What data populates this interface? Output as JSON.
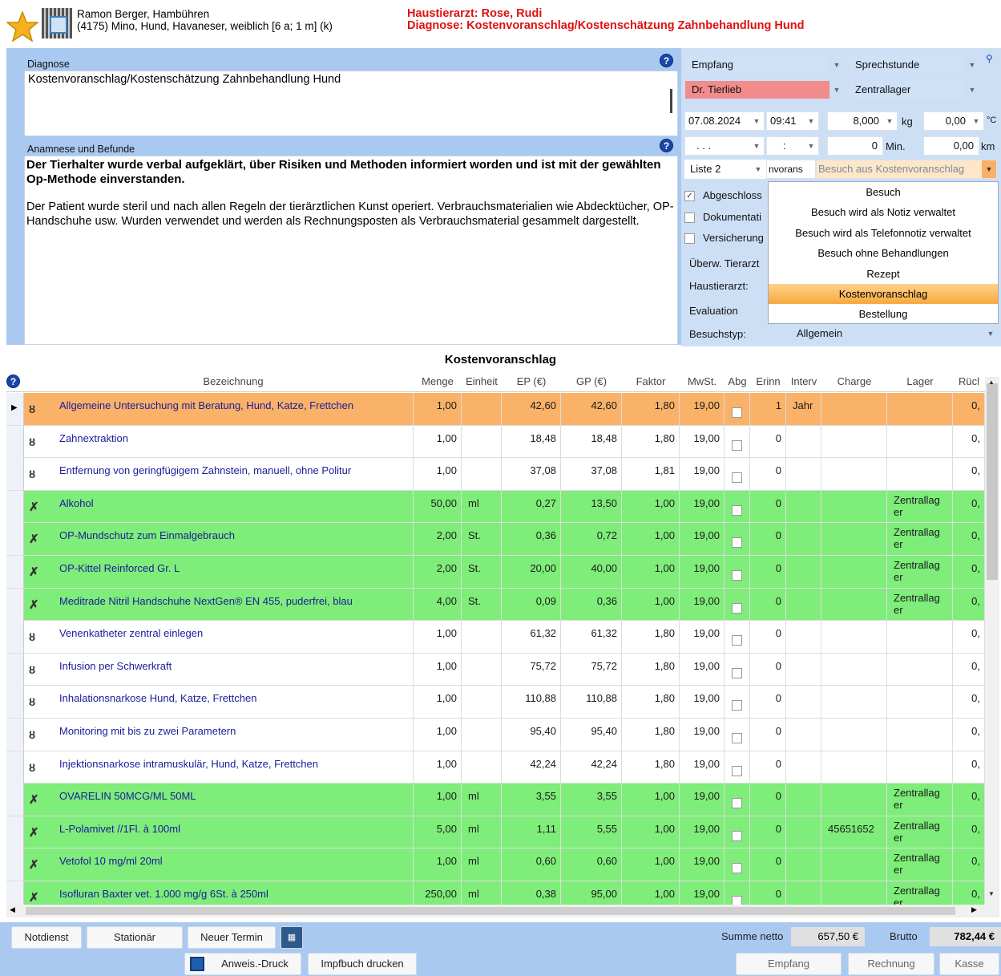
{
  "header": {
    "patient_line1": "Ramon Berger, Hambühren",
    "patient_line2": "(4175) Mino, Hund, Havaneser, weiblich [6 a; 1 m] (k)",
    "vet_line": "Haustierarzt: Rose, Rudi",
    "diagnosis_line": "Diagnose: Kostenvoranschlag/Kostenschätzung Zahnbehandlung Hund"
  },
  "left": {
    "diagnose_label": "Diagnose",
    "diagnose_text": "Kostenvoranschlag/Kostenschätzung Zahnbehandlung Hund",
    "anamnese_label": "Anamnese und Befunde",
    "anamnese_bold": "Der Tierhalter wurde verbal aufgeklärt, über Risiken und Methoden informiert worden und ist mit der gewählten Op-Methode einverstanden.",
    "anamnese_text": "Der Patient wurde steril und nach allen Regeln der tierärztlichen Kunst operiert. Verbrauchsmaterialien wie Abdecktücher, OP-Handschuhe usw. Wurden verwendet und werden als Rechnungsposten als Verbrauchsmaterial gesammelt dargestellt.",
    "help": "?"
  },
  "right": {
    "empfang": "Empfang",
    "sprechstunde": "Sprechstunde",
    "doctor": "Dr. Tierlieb",
    "lager": "Zentrallager",
    "date": "07.08.2024",
    "time": "09:41",
    "weight": "8,000",
    "weight_unit": "kg",
    "temp": "0,00",
    "temp_unit": "°C",
    "date2": ". . .",
    "time2": ":",
    "minutes": "0",
    "min_unit": "Min.",
    "km": "0,00",
    "km_unit": "km",
    "liste": "Liste 2",
    "besuchstyp_partial": "nvorans",
    "besuch_selected": "Besuch aus Kostenvoranschlag",
    "abgeschlossen": "Abgeschloss",
    "dokumentation": "Dokumentati",
    "versicherung": "Versicherung",
    "ueberw": "Überw. Tierarzt",
    "haustierarzt": "Haustierarzt:",
    "evaluation": "Evaluation",
    "besuchstyp_label": "Besuchstyp:",
    "besuchstyp_value": "Allgemein"
  },
  "popup": {
    "items": [
      "Besuch",
      "Besuch wird als Notiz verwaltet",
      "Besuch wird als Telefonnotiz verwaltet",
      "Besuch ohne Behandlungen",
      "Rezept",
      "Kostenvoranschlag",
      "Bestellung"
    ],
    "selected_index": 5
  },
  "grid": {
    "title": "Kostenvoranschlag",
    "help": "?",
    "columns": [
      "Bezeichnung",
      "Menge",
      "Einheit",
      "EP (€)",
      "GP (€)",
      "Faktor",
      "MwSt.",
      "Abg",
      "Erinn",
      "Interv",
      "Charge",
      "Lager",
      "Rücl"
    ],
    "rows": [
      {
        "type": "service",
        "name": "Allgemeine Untersuchung mit Beratung, Hund, Katze, Frettchen",
        "menge": "1,00",
        "einheit": "",
        "ep": "42,60",
        "gp": "42,60",
        "faktor": "1,80",
        "mwst": "19,00",
        "erinn": "1",
        "interv": "Jahr",
        "charge": "",
        "lager": "",
        "rueck": "0,",
        "selected": true
      },
      {
        "type": "service",
        "name": "Zahnextraktion",
        "menge": "1,00",
        "einheit": "",
        "ep": "18,48",
        "gp": "18,48",
        "faktor": "1,80",
        "mwst": "19,00",
        "erinn": "0",
        "interv": "",
        "charge": "",
        "lager": "",
        "rueck": "0,"
      },
      {
        "type": "service",
        "name": "Entfernung von geringfügigem Zahnstein, manuell, ohne Politur",
        "menge": "1,00",
        "einheit": "",
        "ep": "37,08",
        "gp": "37,08",
        "faktor": "1,81",
        "mwst": "19,00",
        "erinn": "0",
        "interv": "",
        "charge": "",
        "lager": "",
        "rueck": "0,"
      },
      {
        "type": "material",
        "name": "Alkohol",
        "menge": "50,00",
        "einheit": "ml",
        "ep": "0,27",
        "gp": "13,50",
        "faktor": "1,00",
        "mwst": "19,00",
        "erinn": "0",
        "interv": "",
        "charge": "",
        "lager": "Zentrallag er",
        "rueck": "0,"
      },
      {
        "type": "material",
        "name": "OP-Mundschutz zum Einmalgebrauch",
        "menge": "2,00",
        "einheit": "St.",
        "ep": "0,36",
        "gp": "0,72",
        "faktor": "1,00",
        "mwst": "19,00",
        "erinn": "0",
        "interv": "",
        "charge": "",
        "lager": "Zentrallag er",
        "rueck": "0,"
      },
      {
        "type": "material",
        "name": "OP-Kittel Reinforced Gr. L",
        "menge": "2,00",
        "einheit": "St.",
        "ep": "20,00",
        "gp": "40,00",
        "faktor": "1,00",
        "mwst": "19,00",
        "erinn": "0",
        "interv": "",
        "charge": "",
        "lager": "Zentrallag er",
        "rueck": "0,"
      },
      {
        "type": "material",
        "name": "Meditrade Nitril Handschuhe NextGen® EN 455, puderfrei, blau",
        "menge": "4,00",
        "einheit": "St.",
        "ep": "0,09",
        "gp": "0,36",
        "faktor": "1,00",
        "mwst": "19,00",
        "erinn": "0",
        "interv": "",
        "charge": "",
        "lager": "Zentrallag er",
        "rueck": "0,"
      },
      {
        "type": "service",
        "name": "Venenkatheter zentral einlegen",
        "menge": "1,00",
        "einheit": "",
        "ep": "61,32",
        "gp": "61,32",
        "faktor": "1,80",
        "mwst": "19,00",
        "erinn": "0",
        "interv": "",
        "charge": "",
        "lager": "",
        "rueck": "0,"
      },
      {
        "type": "service",
        "name": "Infusion per Schwerkraft",
        "menge": "1,00",
        "einheit": "",
        "ep": "75,72",
        "gp": "75,72",
        "faktor": "1,80",
        "mwst": "19,00",
        "erinn": "0",
        "interv": "",
        "charge": "",
        "lager": "",
        "rueck": "0,"
      },
      {
        "type": "service",
        "name": "Inhalationsnarkose Hund, Katze, Frettchen",
        "menge": "1,00",
        "einheit": "",
        "ep": "110,88",
        "gp": "110,88",
        "faktor": "1,80",
        "mwst": "19,00",
        "erinn": "0",
        "interv": "",
        "charge": "",
        "lager": "",
        "rueck": "0,"
      },
      {
        "type": "service",
        "name": "Monitoring mit bis zu zwei Parametern",
        "menge": "1,00",
        "einheit": "",
        "ep": "95,40",
        "gp": "95,40",
        "faktor": "1,80",
        "mwst": "19,00",
        "erinn": "0",
        "interv": "",
        "charge": "",
        "lager": "",
        "rueck": "0,"
      },
      {
        "type": "service",
        "name": "Injektionsnarkose intramuskulär, Hund, Katze, Frettchen",
        "menge": "1,00",
        "einheit": "",
        "ep": "42,24",
        "gp": "42,24",
        "faktor": "1,80",
        "mwst": "19,00",
        "erinn": "0",
        "interv": "",
        "charge": "",
        "lager": "",
        "rueck": "0,"
      },
      {
        "type": "material",
        "name": "OVARELIN 50MCG/ML 50ML",
        "menge": "1,00",
        "einheit": "ml",
        "ep": "3,55",
        "gp": "3,55",
        "faktor": "1,00",
        "mwst": "19,00",
        "erinn": "0",
        "interv": "",
        "charge": "",
        "lager": "Zentrallag er",
        "rueck": "0,"
      },
      {
        "type": "material",
        "name": "L-Polamivet //1Fl. à 100ml",
        "menge": "5,00",
        "einheit": "ml",
        "ep": "1,11",
        "gp": "5,55",
        "faktor": "1,00",
        "mwst": "19,00",
        "erinn": "0",
        "interv": "",
        "charge": "45651652",
        "lager": "Zentrallag er",
        "rueck": "0,"
      },
      {
        "type": "material",
        "name": "Vetofol 10 mg/ml 20ml",
        "menge": "1,00",
        "einheit": "ml",
        "ep": "0,60",
        "gp": "0,60",
        "faktor": "1,00",
        "mwst": "19,00",
        "erinn": "0",
        "interv": "",
        "charge": "",
        "lager": "Zentrallag er",
        "rueck": "0,"
      },
      {
        "type": "material",
        "name": "Isofluran Baxter vet. 1.000 mg/g 6St. à 250ml",
        "menge": "250,00",
        "einheit": "ml",
        "ep": "0,38",
        "gp": "95,00",
        "faktor": "1,00",
        "mwst": "19,00",
        "erinn": "0",
        "interv": "",
        "charge": "",
        "lager": "Zentrallag er",
        "rueck": "0,"
      }
    ]
  },
  "buttons": {
    "notdienst": "Notdienst",
    "stationaer": "Stationär",
    "neuer_termin": "Neuer Termin",
    "anweis": "Anweis.-Druck",
    "impfbuch": "Impfbuch drucken",
    "empfang": "Empfang",
    "rechnung": "Rechnung",
    "kasse": "Kasse"
  },
  "summary": {
    "netto_label": "Summe netto",
    "netto_value": "657,50 €",
    "brutto_label": "Brutto",
    "brutto_value": "782,44 €"
  },
  "colors": {
    "material_row": "#7eed79",
    "selected_row": "#f9b268",
    "doctor_bg": "#f28b8b",
    "header_red": "#e01010",
    "panel_blue": "#a9c9f0"
  }
}
